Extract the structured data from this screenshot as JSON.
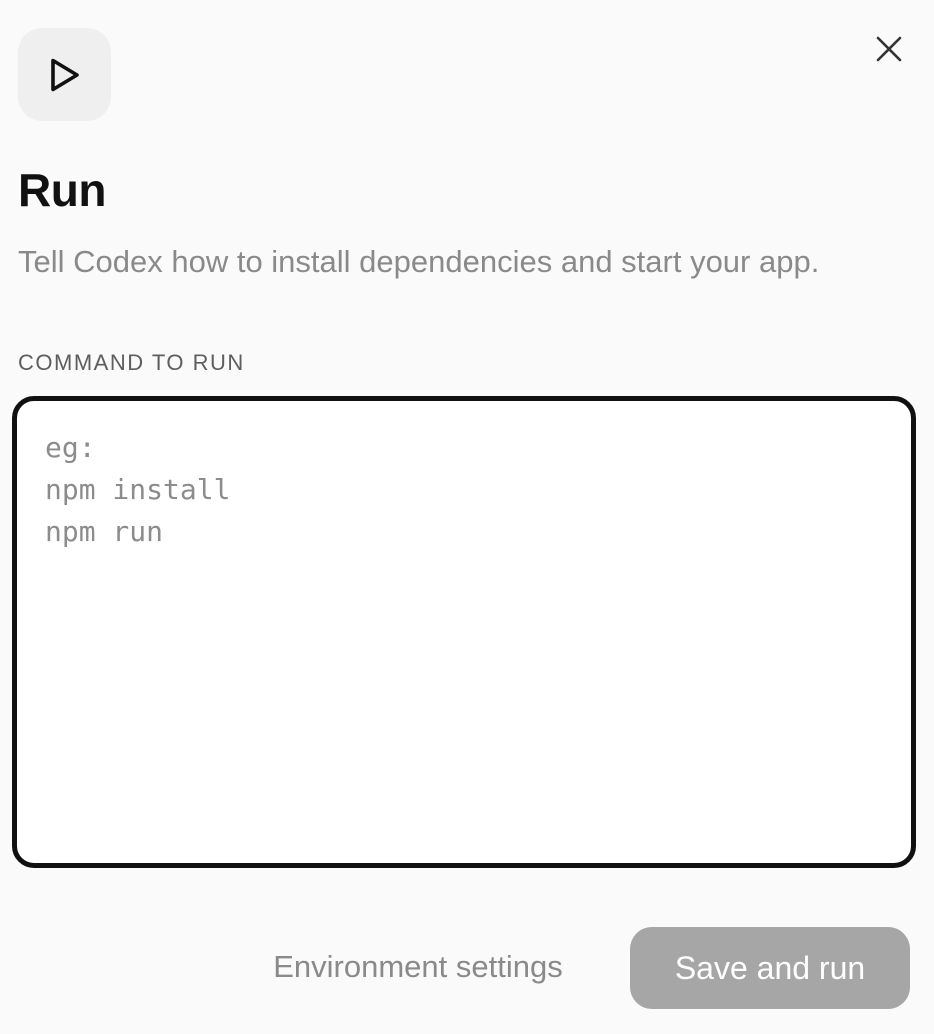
{
  "header": {
    "icon": "play-icon",
    "close_icon": "close-icon"
  },
  "title": "Run",
  "subtitle": "Tell Codex how to install dependencies and start your app.",
  "command": {
    "label": "COMMAND TO RUN",
    "placeholder_lines": [
      "eg:",
      "npm install",
      "npm run"
    ],
    "value": ""
  },
  "footer": {
    "environment_settings_label": "Environment settings",
    "save_and_run_label": "Save and run"
  },
  "colors": {
    "background": "#fafafa",
    "icon_tile": "#efefef",
    "box_border": "#111111",
    "save_button_disabled": "#a6a6a6",
    "muted_text": "#8a8a8a"
  }
}
